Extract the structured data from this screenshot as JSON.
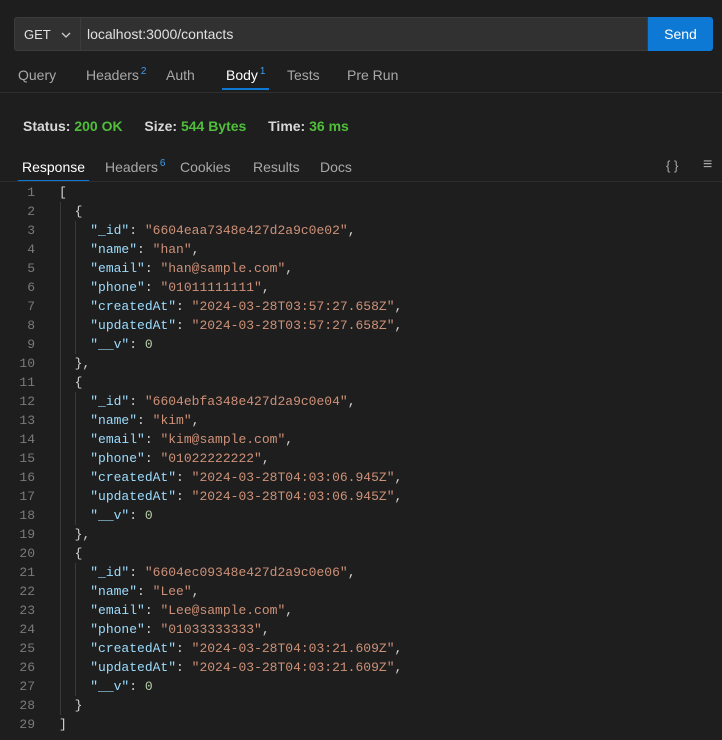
{
  "request": {
    "method": "GET",
    "url": "localhost:3000/contacts",
    "send_label": "Send"
  },
  "request_tabs": [
    {
      "label": "Query",
      "badge": ""
    },
    {
      "label": "Headers",
      "badge": "2"
    },
    {
      "label": "Auth",
      "badge": ""
    },
    {
      "label": "Body",
      "badge": "1"
    },
    {
      "label": "Tests",
      "badge": ""
    },
    {
      "label": "Pre Run",
      "badge": ""
    }
  ],
  "status": {
    "status_label": "Status:",
    "status_value": "200 OK",
    "size_label": "Size:",
    "size_value": "544 Bytes",
    "time_label": "Time:",
    "time_value": "36 ms"
  },
  "response_tabs": [
    {
      "label": "Response",
      "badge": ""
    },
    {
      "label": "Headers",
      "badge": "6"
    },
    {
      "label": "Cookies",
      "badge": ""
    },
    {
      "label": "Results",
      "badge": ""
    },
    {
      "label": "Docs",
      "badge": ""
    }
  ],
  "toolbar_icons": {
    "braces": "{ }",
    "menu": "≡"
  },
  "colors": {
    "accent": "#0e79d4",
    "status_green": "#4fbf3a",
    "json_key": "#9cdcfe",
    "json_string": "#ce9178",
    "json_number": "#b5cea8"
  },
  "response_body": [
    {
      "_id": "6604eaa7348e427d2a9c0e02",
      "name": "han",
      "email": "han@sample.com",
      "phone": "01011111111",
      "createdAt": "2024-03-28T03:57:27.658Z",
      "updatedAt": "2024-03-28T03:57:27.658Z",
      "__v": 0
    },
    {
      "_id": "6604ebfa348e427d2a9c0e04",
      "name": "kim",
      "email": "kim@sample.com",
      "phone": "01022222222",
      "createdAt": "2024-03-28T04:03:06.945Z",
      "updatedAt": "2024-03-28T04:03:06.945Z",
      "__v": 0
    },
    {
      "_id": "6604ec09348e427d2a9c0e06",
      "name": "Lee",
      "email": "Lee@sample.com",
      "phone": "01033333333",
      "createdAt": "2024-03-28T04:03:21.609Z",
      "updatedAt": "2024-03-28T04:03:21.609Z",
      "__v": 0
    }
  ]
}
